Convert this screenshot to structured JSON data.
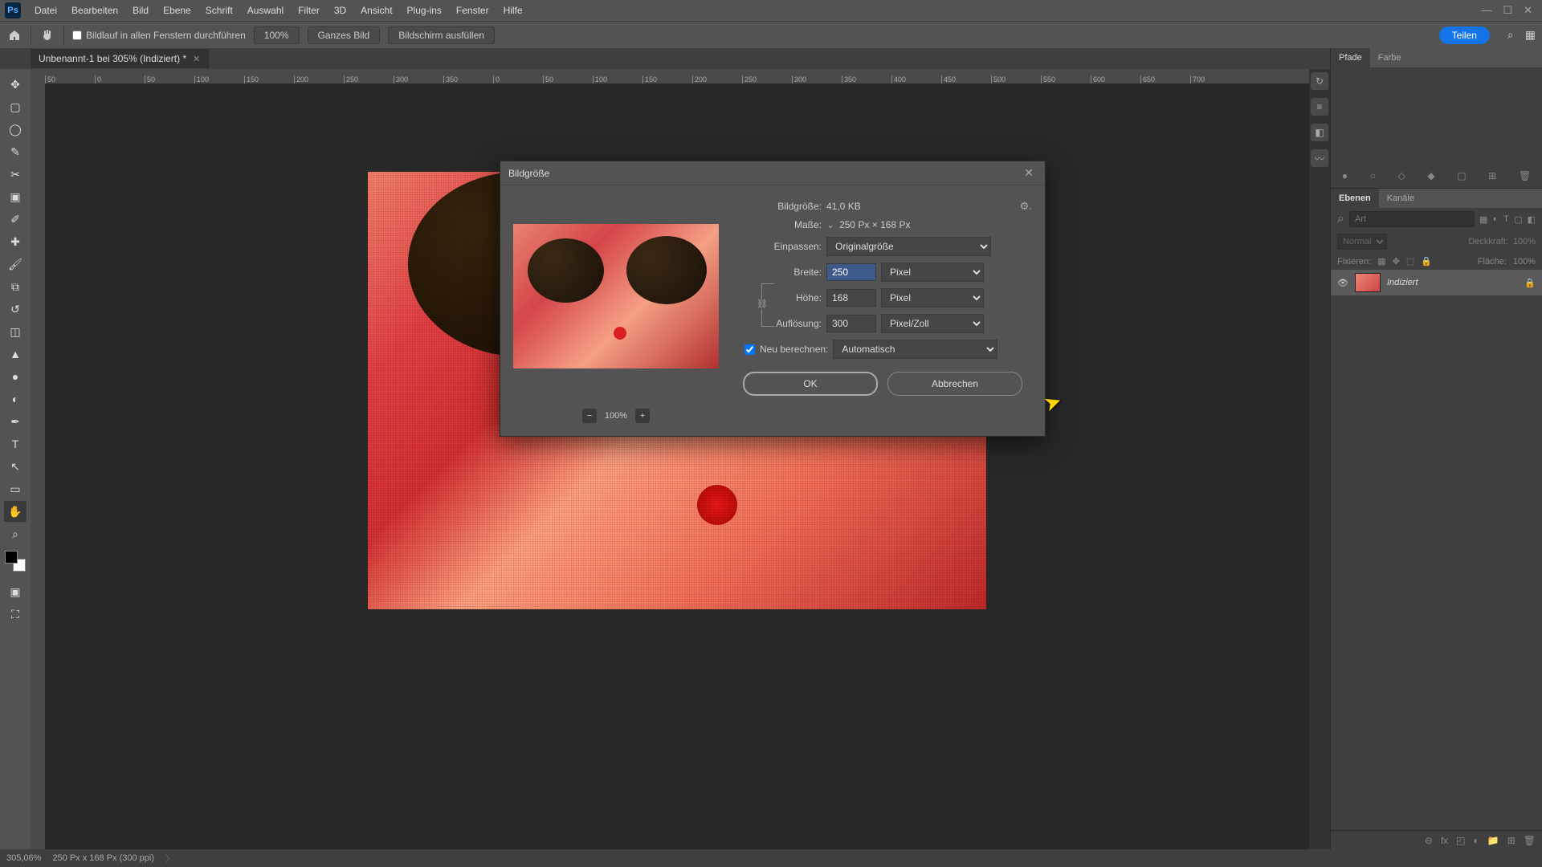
{
  "menubar": {
    "items": [
      "Datei",
      "Bearbeiten",
      "Bild",
      "Ebene",
      "Schrift",
      "Auswahl",
      "Filter",
      "3D",
      "Ansicht",
      "Plug-ins",
      "Fenster",
      "Hilfe"
    ]
  },
  "optionsbar": {
    "scroll_all_label": "Bildlauf in allen Fenstern durchführen",
    "zoom": "100%",
    "fit_label": "Ganzes Bild",
    "fill_label": "Bildschirm ausfüllen",
    "share_label": "Teilen"
  },
  "doctab": {
    "title": "Unbenannt-1 bei 305% (Indiziert) *"
  },
  "ruler_marks": [
    "50",
    "0",
    "50",
    "100",
    "150",
    "200",
    "250",
    "300",
    "50",
    "0",
    "50",
    "100",
    "150",
    "200",
    "250",
    "300"
  ],
  "dialog": {
    "title": "Bildgröße",
    "size_label": "Bildgröße:",
    "size_value": "41,0 KB",
    "dim_label": "Maße:",
    "dim_value": "250 Px × 168 Px",
    "fit_label": "Einpassen:",
    "fit_value": "Originalgröße",
    "width_label": "Breite:",
    "width_value": "250",
    "height_label": "Höhe:",
    "height_value": "168",
    "unit_px": "Pixel",
    "res_label": "Auflösung:",
    "res_value": "300",
    "res_unit": "Pixel/Zoll",
    "resample_label": "Neu berechnen:",
    "resample_value": "Automatisch",
    "zoom_value": "100%",
    "ok_label": "OK",
    "cancel_label": "Abbrechen"
  },
  "panels": {
    "top_tabs": [
      "Pfade",
      "Farbe"
    ],
    "layer_tabs": [
      "Ebenen",
      "Kanäle"
    ],
    "search_placeholder": "Art",
    "blend_mode": "Normal",
    "opacity_label": "Deckkraft:",
    "opacity_value": "100%",
    "lock_label": "Fixieren:",
    "fill_label": "Fläche:",
    "fill_value": "100%",
    "layer_name": "Indiziert"
  },
  "statusbar": {
    "zoom": "305,06%",
    "info": "250 Px x 168 Px (300 ppi)"
  }
}
